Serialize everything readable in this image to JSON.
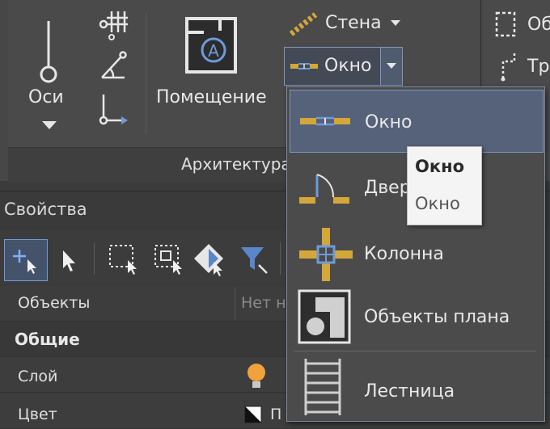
{
  "ribbon": {
    "axes_label": "Оси",
    "room_label": "Помещение",
    "wall_label": "Стена",
    "window_label": "Окно",
    "panel_title": "Архитектура",
    "right_item_1": "Об",
    "right_item_2": "Тр"
  },
  "dropdown": {
    "items": [
      {
        "label": "Окно",
        "icon": "window-icon"
      },
      {
        "label": "Двери",
        "icon": "door-icon"
      },
      {
        "label": "Колонна",
        "icon": "column-icon"
      },
      {
        "label": "Объекты плана",
        "icon": "plan-objects-icon"
      },
      {
        "label": "Лестница",
        "icon": "stairs-icon"
      }
    ]
  },
  "tooltip": {
    "title": "Окно",
    "description": "Окно"
  },
  "properties": {
    "title": "Свойства",
    "rows": [
      {
        "label": "Объекты",
        "value": "Нет на"
      },
      {
        "label": "Общие",
        "value": ""
      },
      {
        "label": "Слой",
        "value": ""
      },
      {
        "label": "Цвет",
        "value": "П"
      }
    ]
  },
  "colors": {
    "accent": "#6f9ad8",
    "hatch": "#d4a73a",
    "selected": "#55627a"
  }
}
